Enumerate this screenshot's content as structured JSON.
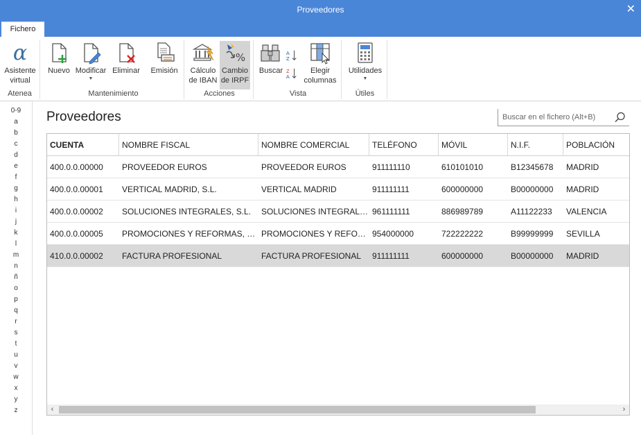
{
  "window": {
    "title": "Proveedores",
    "close_glyph": "✕"
  },
  "ribbon": {
    "tab_label": "Fichero",
    "groups": {
      "atenea": {
        "label": "Atenea",
        "asistente": "Asistente virtual"
      },
      "mantenimiento": {
        "label": "Mantenimiento",
        "nuevo": "Nuevo",
        "modificar": "Modificar",
        "eliminar": "Eliminar",
        "emision": "Emisión"
      },
      "acciones": {
        "label": "Acciones",
        "calculo_iban": "Cálculo de IBAN",
        "cambio_irpf": "Cambio de IRPF"
      },
      "vista": {
        "label": "Vista",
        "buscar": "Buscar",
        "elegir_columnas": "Elegir columnas"
      },
      "utiles": {
        "label": "Útiles",
        "utilidades": "Utilidades"
      }
    }
  },
  "alphabet": [
    "0-9",
    "a",
    "b",
    "c",
    "d",
    "e",
    "f",
    "g",
    "h",
    "i",
    "j",
    "k",
    "l",
    "m",
    "n",
    "ñ",
    "o",
    "p",
    "q",
    "r",
    "s",
    "t",
    "u",
    "v",
    "w",
    "x",
    "y",
    "z"
  ],
  "main": {
    "title": "Proveedores",
    "search_placeholder": "Buscar en el fichero (Alt+B)"
  },
  "table": {
    "columns": [
      "CUENTA",
      "NOMBRE FISCAL",
      "NOMBRE COMERCIAL",
      "TELÉFONO",
      "MÓVIL",
      "N.I.F.",
      "POBLACIÓN"
    ],
    "rows": [
      [
        "400.0.0.00000",
        "PROVEEDOR EUROS",
        "PROVEEDOR EUROS",
        "911111110",
        "610101010",
        "B12345678",
        "MADRID"
      ],
      [
        "400.0.0.00001",
        "VERTICAL MADRID, S.L.",
        "VERTICAL MADRID",
        "911111111",
        "600000000",
        "B00000000",
        "MADRID"
      ],
      [
        "400.0.0.00002",
        "SOLUCIONES INTEGRALES, S.L.",
        "SOLUCIONES INTEGRALES,...",
        "961111111",
        "886989789",
        "A11122233",
        "VALENCIA"
      ],
      [
        "400.0.0.00005",
        "PROMOCIONES Y REFORMAS, S.L.",
        "PROMOCIONES Y REFOR...",
        "954000000",
        "722222222",
        "B99999999",
        "SEVILLA"
      ],
      [
        "410.0.0.00002",
        "FACTURA PROFESIONAL",
        "FACTURA PROFESIONAL",
        "911111111",
        "600000000",
        "B00000000",
        "MADRID"
      ]
    ],
    "selected_row": 4,
    "scroll_left_glyph": "‹",
    "scroll_right_glyph": "›"
  },
  "colors": {
    "title_bar": "#4a86d8",
    "selected_row": "#d9d9d9"
  }
}
